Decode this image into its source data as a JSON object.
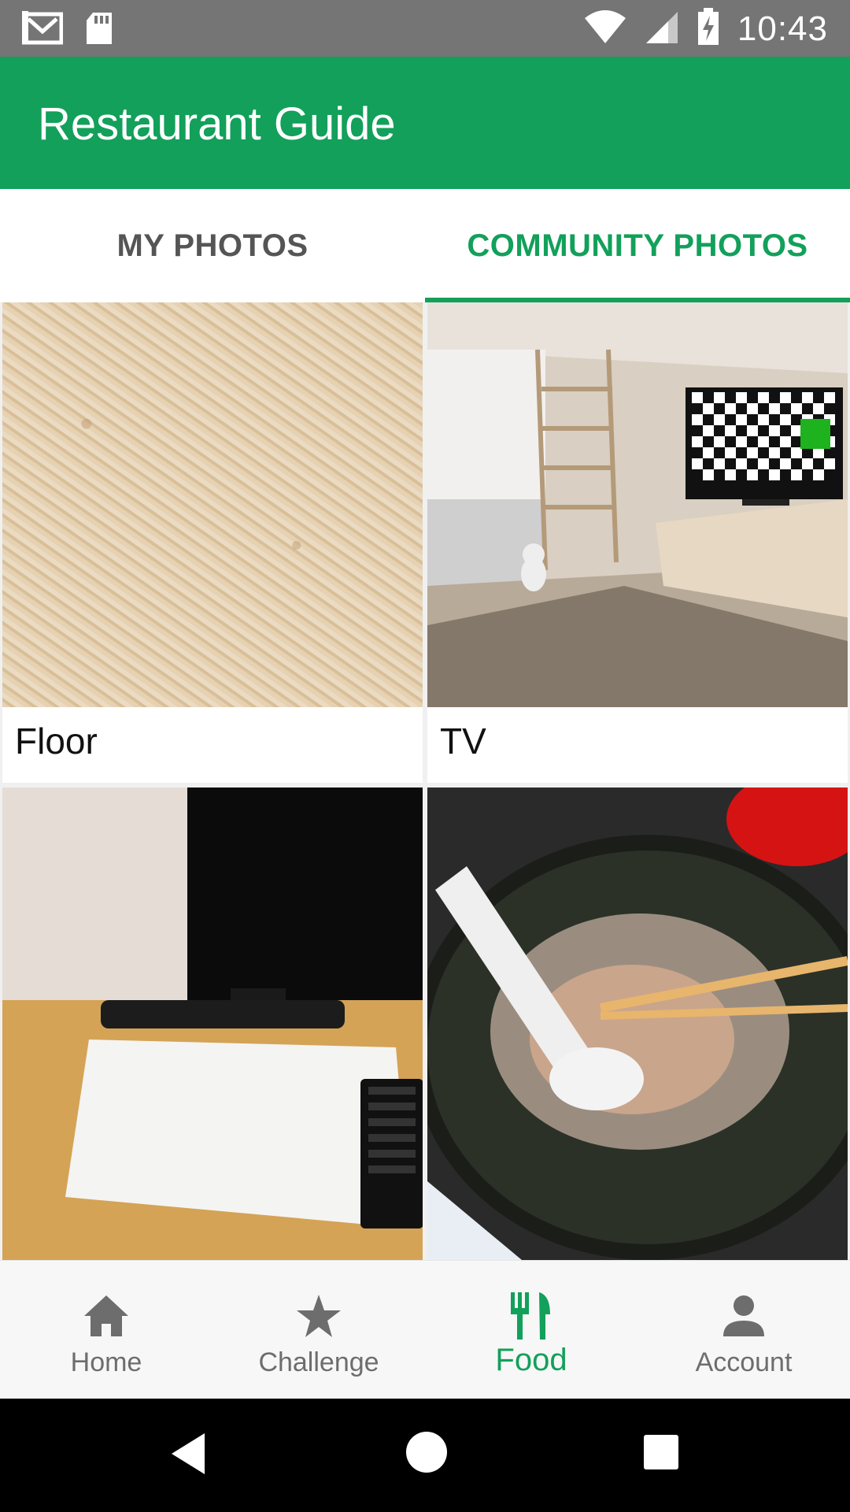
{
  "status_bar": {
    "time": "10:43",
    "icons": [
      "gmail-icon",
      "sd-card-icon",
      "wifi-icon",
      "cell-signal-icon",
      "battery-charging-icon"
    ]
  },
  "app_bar": {
    "title": "Restaurant Guide",
    "color": "#12a05a"
  },
  "tabs": [
    {
      "label": "MY PHOTOS",
      "selected": false
    },
    {
      "label": "COMMUNITY PHOTOS",
      "selected": true
    }
  ],
  "photos": [
    {
      "caption": "Floor",
      "description": "carpet texture"
    },
    {
      "caption": "TV",
      "description": "room with tv and checkerboard screen"
    },
    {
      "caption": "",
      "description": "desk with monitor and paper"
    },
    {
      "caption": "",
      "description": "bowl of soup with spoon and chopsticks"
    }
  ],
  "bottom_nav": {
    "items": [
      {
        "label": "Home",
        "icon": "home-icon",
        "active": false
      },
      {
        "label": "Challenge",
        "icon": "star-icon",
        "active": false
      },
      {
        "label": "Food",
        "icon": "fork-knife-icon",
        "active": true
      },
      {
        "label": "Account",
        "icon": "person-icon",
        "active": false
      }
    ]
  },
  "system_nav": {
    "buttons": [
      "back-icon",
      "home-circle-icon",
      "recents-icon"
    ]
  },
  "colors": {
    "accent": "#12a05a",
    "status_bar": "#757575",
    "inactive_nav": "#6d6d6d"
  }
}
